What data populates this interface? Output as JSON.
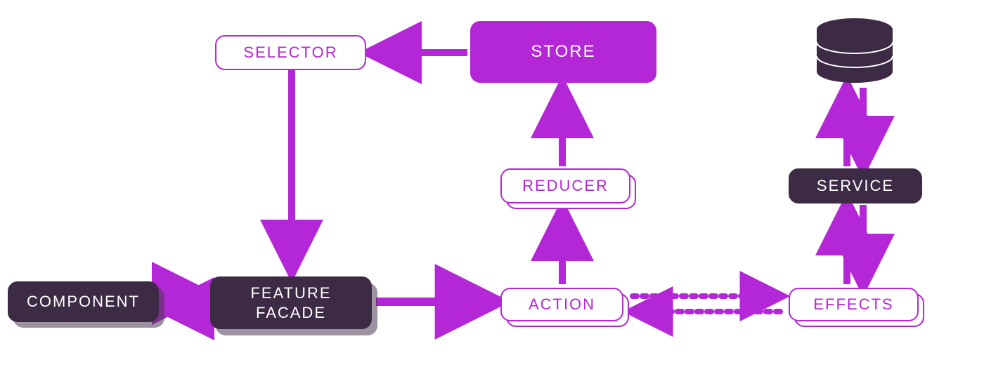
{
  "diagram": {
    "nodes": {
      "component": {
        "label": "COMPONENT",
        "style": "dark",
        "stacked": true
      },
      "feature_facade": {
        "label": "FEATURE\nFACADE",
        "style": "dark",
        "stacked": true
      },
      "selector": {
        "label": "SELECTOR",
        "style": "outlined",
        "stacked": false
      },
      "store": {
        "label": "STORE",
        "style": "filled",
        "stacked": false
      },
      "reducer": {
        "label": "REDUCER",
        "style": "outlined",
        "stacked": true
      },
      "action": {
        "label": "ACTION",
        "style": "outlined",
        "stacked": true
      },
      "effects": {
        "label": "EFFECTS",
        "style": "outlined",
        "stacked": true
      },
      "service": {
        "label": "SERVICE",
        "style": "dark",
        "stacked": false
      },
      "database": {
        "label": "",
        "style": "icon",
        "stacked": false
      }
    },
    "edges": [
      {
        "from": "component",
        "to": "feature_facade",
        "dir": "both",
        "style": "solid"
      },
      {
        "from": "feature_facade",
        "to": "action",
        "dir": "forward",
        "style": "solid"
      },
      {
        "from": "selector",
        "to": "feature_facade",
        "dir": "forward",
        "style": "solid"
      },
      {
        "from": "store",
        "to": "selector",
        "dir": "forward",
        "style": "solid"
      },
      {
        "from": "reducer",
        "to": "store",
        "dir": "forward",
        "style": "solid"
      },
      {
        "from": "action",
        "to": "reducer",
        "dir": "forward",
        "style": "solid"
      },
      {
        "from": "action",
        "to": "effects",
        "dir": "both",
        "style": "dashed"
      },
      {
        "from": "effects",
        "to": "service",
        "dir": "both",
        "style": "solid"
      },
      {
        "from": "service",
        "to": "database",
        "dir": "both",
        "style": "solid"
      }
    ],
    "colors": {
      "accent": "#b327d6",
      "dark": "#3d2a45",
      "shadow": "#4b3952"
    }
  }
}
